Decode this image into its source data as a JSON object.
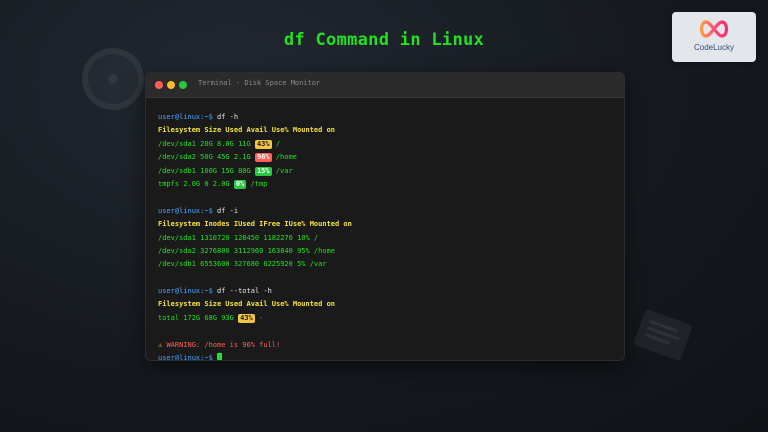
{
  "page": {
    "title": "df Command in Linux"
  },
  "logo": {
    "text": "CodeLucky"
  },
  "terminal": {
    "window_title": "Terminal - Disk Space Monitor",
    "prompt": "user@linux:~$",
    "blocks": [
      {
        "command": "df -h",
        "header": "Filesystem Size Used Avail Use% Mounted on",
        "rows": [
          {
            "pre": "/dev/sda1 20G 8.0G 11G",
            "badge": "43%",
            "badge_status": "warn",
            "post": "/"
          },
          {
            "pre": "/dev/sda2 50G 45G 2.1G",
            "badge": "96%",
            "badge_status": "critical",
            "post": "/home"
          },
          {
            "pre": "/dev/sdb1 100G 15G 80G",
            "badge": "15%",
            "badge_status": "ok",
            "post": "/var"
          },
          {
            "pre": "tmpfs 2.0G 0 2.0G",
            "badge": "0%",
            "badge_status": "ok",
            "post": "/tmp"
          }
        ]
      },
      {
        "command": "df -i",
        "header": "Filesystem Inodes IUsed IFree IUse% Mounted on",
        "rows": [
          {
            "text": "/dev/sda1 1310720 128450 1182270 10% /"
          },
          {
            "text": "/dev/sda2 3276800 3112960 163840 95% /home"
          },
          {
            "text": "/dev/sdb1 6553600 327680 6225920 5% /var"
          }
        ]
      },
      {
        "command": "df --total -h",
        "header": "Filesystem Size Used Avail Use% Mounted on",
        "rows": [
          {
            "pre": "total 172G 68G 93G",
            "badge": "43%",
            "badge_status": "warn",
            "post": "-"
          }
        ]
      }
    ],
    "warning_icon": "warning-triangle-icon",
    "warning": "WARNING: /home is 96% full!"
  },
  "colors": {
    "title_green": "#22e022",
    "prompt_blue": "#4aa3ff",
    "header_yellow": "#f4e43b",
    "badge_warn": "#f4c542",
    "badge_critical": "#ff5f56",
    "badge_ok": "#27c93f"
  }
}
